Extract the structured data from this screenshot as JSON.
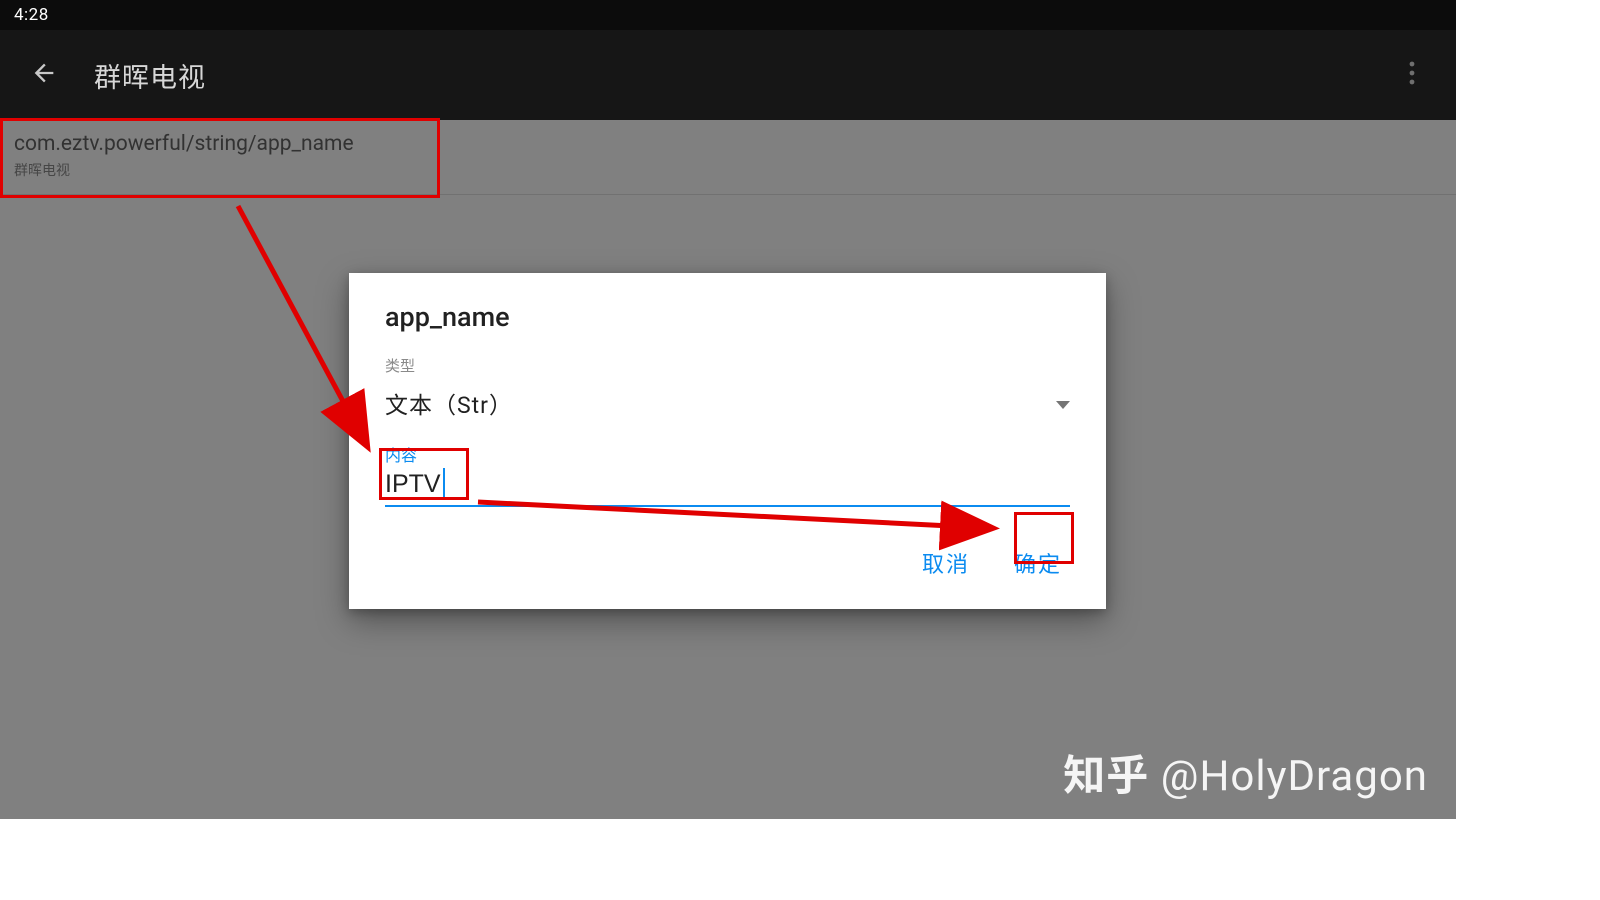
{
  "statusbar": {
    "time": "4:28"
  },
  "appbar": {
    "title": "群晖电视"
  },
  "list": {
    "item0": {
      "primary": "com.eztv.powerful/string/app_name",
      "secondary": "群晖电视"
    }
  },
  "dialog": {
    "title": "app_name",
    "type_label": "类型",
    "type_value": "文本（Str）",
    "content_label": "内容",
    "input_value": "IPTV",
    "cancel": "取消",
    "ok": "确定"
  },
  "watermark": {
    "site": "知乎",
    "handle": "@HolyDragon"
  }
}
